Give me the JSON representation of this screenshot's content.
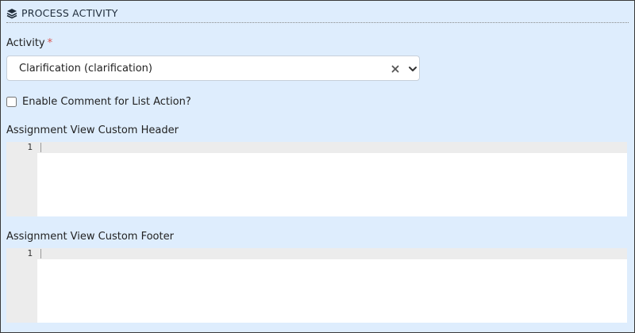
{
  "section": {
    "title": "PROCESS ACTIVITY",
    "icon": "layers-icon"
  },
  "activity": {
    "label": "Activity",
    "required_mark": "*",
    "selected_value": "Clarification (clarification)"
  },
  "enable_comment": {
    "label": "Enable Comment for List Action?",
    "checked": false
  },
  "header_editor": {
    "label": "Assignment View Custom Header",
    "line_numbers": [
      "1"
    ]
  },
  "footer_editor": {
    "label": "Assignment View Custom Footer",
    "line_numbers": [
      "1"
    ]
  },
  "colors": {
    "panel_background": "#deedfd",
    "required": "#d9534f",
    "gutter": "#ececec"
  }
}
